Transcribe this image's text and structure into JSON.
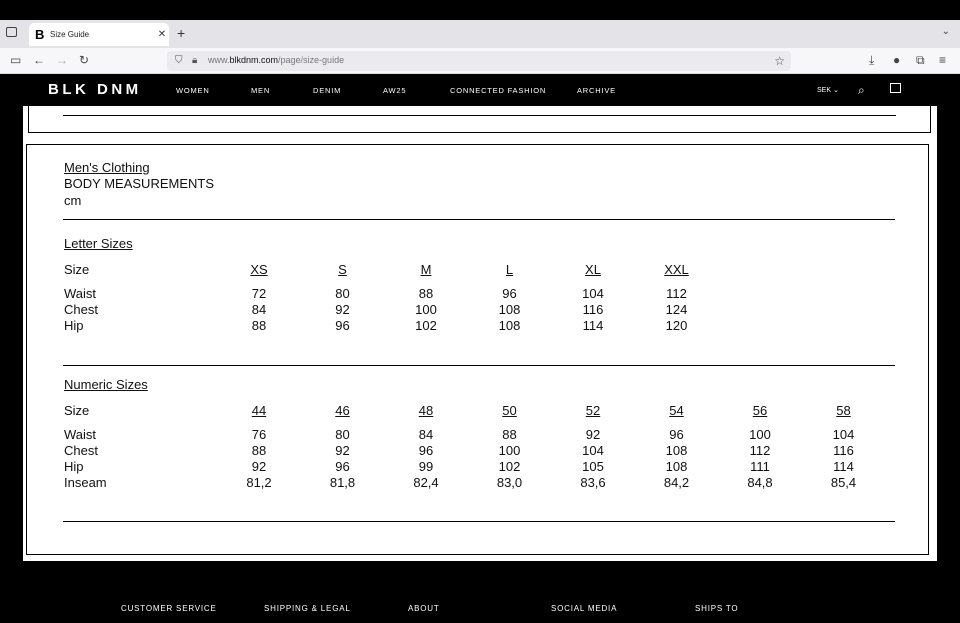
{
  "browser": {
    "tab_title": "Size Guide",
    "favicon": "B",
    "url_prefix": "www.",
    "url_domain": "blkdnm.com",
    "url_path": "/page/size-guide"
  },
  "site": {
    "logo": "BLK DNM",
    "nav": [
      "WOMEN",
      "MEN",
      "DENIM",
      "AW25",
      "CONNECTED FASHION",
      "ARCHIVE"
    ],
    "currency": "SEK"
  },
  "guide": {
    "heading": "Men's Clothing",
    "subheading": "BODY MEASUREMENTS",
    "unit": "cm",
    "letter": {
      "title": "Letter Sizes",
      "size_label": "Size",
      "sizes": [
        "XS",
        "S",
        "M",
        "L",
        "XL",
        "XXL"
      ],
      "rows": [
        {
          "label": "Waist",
          "values": [
            "72",
            "80",
            "88",
            "96",
            "104",
            "112"
          ]
        },
        {
          "label": "Chest",
          "values": [
            "84",
            "92",
            "100",
            "108",
            "116",
            "124"
          ]
        },
        {
          "label": "Hip",
          "values": [
            "88",
            "96",
            "102",
            "108",
            "114",
            "120"
          ]
        }
      ]
    },
    "numeric": {
      "title": "Numeric Sizes",
      "size_label": "Size",
      "sizes": [
        "44",
        "46",
        "48",
        "50",
        "52",
        "54",
        "56",
        "58"
      ],
      "rows": [
        {
          "label": "Waist",
          "values": [
            "76",
            "80",
            "84",
            "88",
            "92",
            "96",
            "100",
            "104"
          ]
        },
        {
          "label": "Chest",
          "values": [
            "88",
            "92",
            "96",
            "100",
            "104",
            "108",
            "112",
            "116"
          ]
        },
        {
          "label": "Hip",
          "values": [
            "92",
            "96",
            "99",
            "102",
            "105",
            "108",
            "111",
            "114"
          ]
        },
        {
          "label": "Inseam",
          "values": [
            "81,2",
            "81,8",
            "82,4",
            "83,0",
            "83,6",
            "84,2",
            "84,8",
            "85,4"
          ]
        }
      ]
    }
  },
  "footer": [
    "CUSTOMER SERVICE",
    "SHIPPING & LEGAL",
    "ABOUT",
    "SOCIAL MEDIA",
    "SHIPS TO"
  ]
}
